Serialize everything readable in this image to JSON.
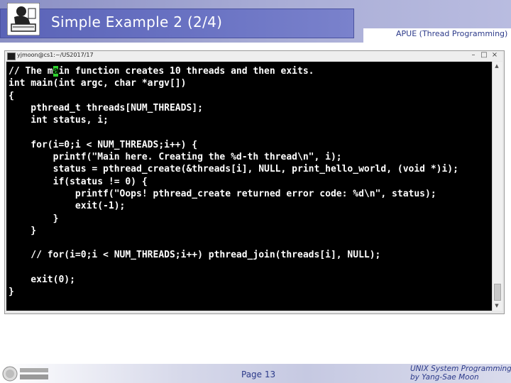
{
  "header": {
    "title": "Simple Example 2 (2/4)",
    "right_label": "APUE (Thread Programming)"
  },
  "terminal": {
    "title": "yjmoon@cs1:~/US2017/17",
    "code_before_cursor": "// The m",
    "cursor_char": "a",
    "code_after_cursor": "in function creates 10 threads and then exits.\nint main(int argc, char *argv[])\n{\n    pthread_t threads[NUM_THREADS];\n    int status, i;\n\n    for(i=0;i < NUM_THREADS;i++) {\n        printf(\"Main here. Creating the %d-th thread\\n\", i);\n        status = pthread_create(&threads[i], NULL, print_hello_world, (void *)i);\n        if(status != 0) {\n            printf(\"Oops! pthread_create returned error code: %d\\n\", status);\n            exit(-1);\n        }\n    }\n\n    // for(i=0;i < NUM_THREADS;i++) pthread_join(threads[i], NULL);\n\n    exit(0);\n}",
    "window_buttons": [
      "–",
      "□",
      "×"
    ]
  },
  "footer": {
    "page": "Page 13",
    "credit_line1": "UNIX System Programming",
    "credit_line2": "by Yang-Sae Moon"
  },
  "colors": {
    "title_bar": "#5a63b7",
    "accent_text": "#2c3a8a",
    "terminal_bg": "#000000",
    "cursor": "#2fd42f"
  }
}
